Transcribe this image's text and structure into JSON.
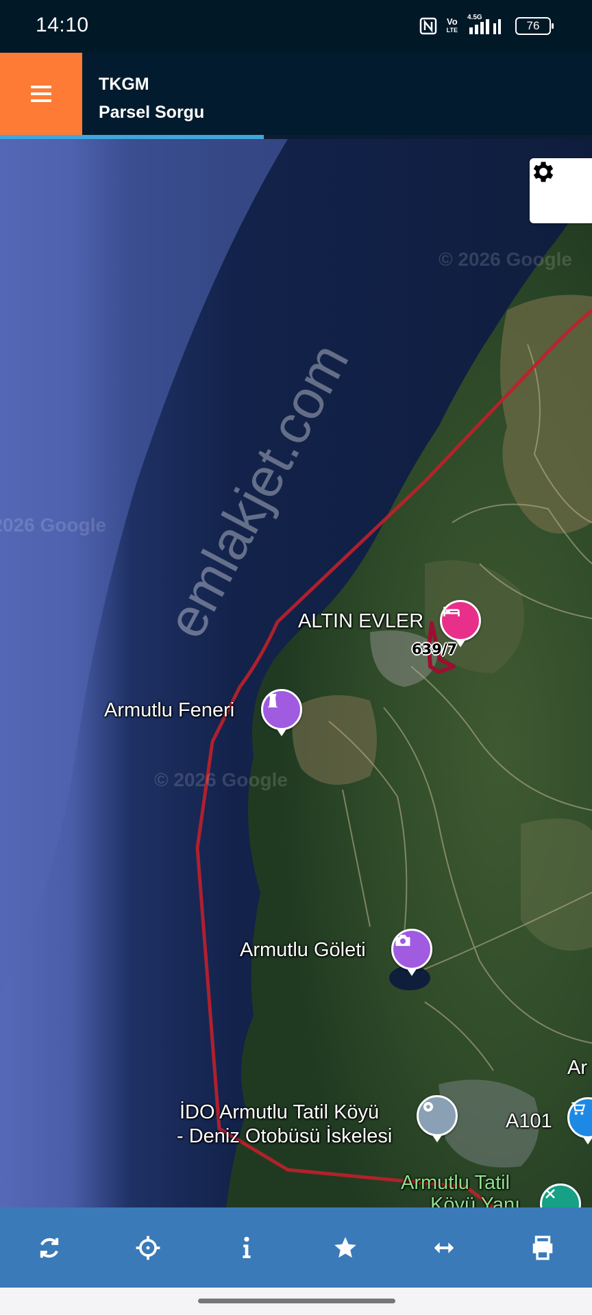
{
  "status_bar": {
    "time": "14:10",
    "volte_top": "Vo",
    "volte_bottom": "LTE",
    "network": "4.5G",
    "battery": "76",
    "icons": [
      "nfc-icon",
      "volte-icon",
      "signal-icon",
      "battery-icon"
    ]
  },
  "app_bar": {
    "title": "TKGM",
    "subtitle": "Parsel Sorgu",
    "menu_icon": "hamburger-icon",
    "accent_color": "#fd7b35",
    "bar_color": "#021b2e"
  },
  "map": {
    "settings_icon": "gear-icon",
    "watermark": "emlakjet.com",
    "copyright": [
      "© 2026 Google",
      "© 2026 Google",
      "© 2026 Google"
    ],
    "parcel_label": "639/7",
    "boundary_color": "#c0202a",
    "places": [
      {
        "name": "ALTIN EVLER",
        "icon": "hotel-icon",
        "color": "#e8308a"
      },
      {
        "name": "Armutlu Feneri",
        "icon": "lighthouse-icon",
        "color": "#a05be0"
      },
      {
        "name": "Armutlu Göleti",
        "icon": "camera-icon",
        "color": "#a05be0"
      },
      {
        "name": "İDO Armutlu Tatil Köyü",
        "name_line2": "- Deniz Otobüsü İskelesi",
        "icon": "pin-icon",
        "color": "#8aa0b4"
      },
      {
        "name": "A101",
        "icon": "cart-icon",
        "color": "#1e88e5"
      },
      {
        "name": "Armutlu Tatil",
        "name_line2": "Köyü Yanı",
        "icon": "tool-icon",
        "color": "#16a085"
      },
      {
        "name": "Ar",
        "icon": null,
        "color": null
      }
    ]
  },
  "toolbar": {
    "color": "#3a7ab8",
    "buttons": [
      "refresh-icon",
      "crosshair-icon",
      "info-icon",
      "star-icon",
      "swap-horizontal-icon",
      "print-icon"
    ]
  }
}
